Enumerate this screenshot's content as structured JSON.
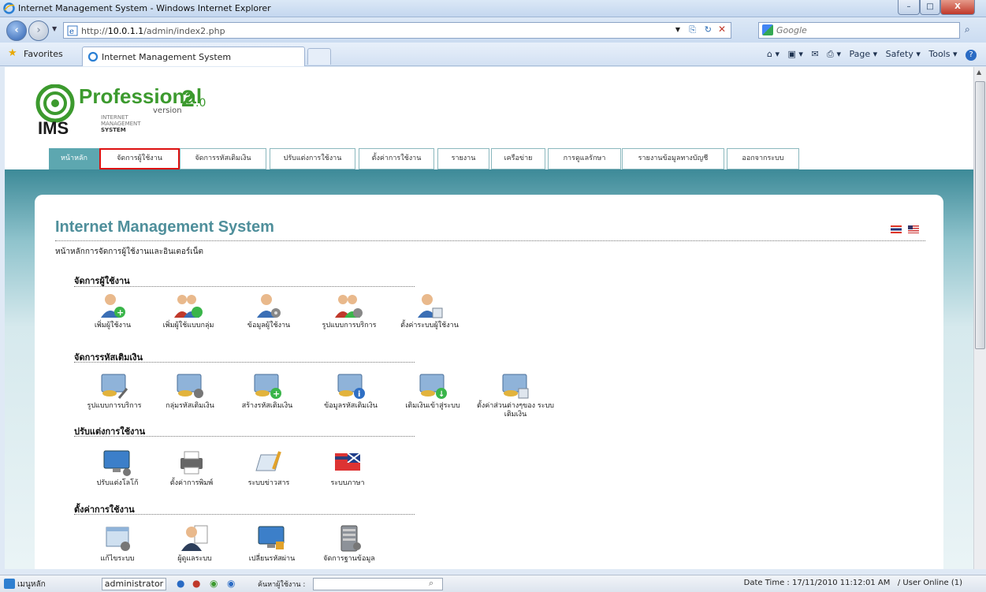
{
  "window": {
    "title": "Internet Management System - Windows Internet Explorer",
    "min": "–",
    "max": "□",
    "close": "X"
  },
  "address": {
    "url_prefix": "http://",
    "url_host": "10.0.1.1",
    "url_path": "/admin/index2.php",
    "search_placeholder": "Google"
  },
  "favbar": {
    "favorites": "Favorites",
    "tab_title": "Internet Management System",
    "page": "Page ▾",
    "safety": "Safety ▾",
    "tools": "Tools ▾",
    "help": "?"
  },
  "logo": {
    "professional": "Professional",
    "two": "2",
    "zero": ".0",
    "version": "version",
    "ims": "IMS",
    "line1": "INTERNET",
    "line2": "MANAGEMENT",
    "line3": "SYSTEM"
  },
  "menu": [
    "หน้าหลัก",
    "จัดการผู้ใช้งาน",
    "จัดการรหัสเติมเงิน",
    "ปรับแต่งการใช้งาน",
    "ตั้งค่าการใช้งาน",
    "รายงาน",
    "เครือข่าย",
    "การดูแลรักษา",
    "รายงานข้อมูลทางบัญชี",
    "ออกจากระบบ"
  ],
  "panel": {
    "title": "Internet Management System",
    "subtitle": "หน้าหลักการจัดการผู้ใช้งานและอินเตอร์เน็ต"
  },
  "sections": [
    {
      "title": "จัดการผู้ใช้งาน",
      "items": [
        "เพิ่มผู้ใช้งาน",
        "เพิ่มผู้ใช้แบบกลุ่ม",
        "ข้อมูลผู้ใช้งาน",
        "รูปแบบการบริการ",
        "ตั้งค่าระบบผู้ใช้งาน"
      ]
    },
    {
      "title": "จัดการรหัสเติมเงิน",
      "items": [
        "รูปแบบการบริการ",
        "กลุ่มรหัสเติมเงิน",
        "สร้างรหัสเติมเงิน",
        "ข้อมูลรหัสเติมเงิน",
        "เติมเงินเข้าสู่ระบบ",
        "ตั้งค่าส่วนต่างๆของ ระบบเติมเงิน"
      ]
    },
    {
      "title": "ปรับแต่งการใช้งาน",
      "items": [
        "ปรับแต่งโลโก้",
        "ตั้งค่าการพิมพ์",
        "ระบบข่าวสาร",
        "ระบบภาษา"
      ]
    },
    {
      "title": "ตั้งค่าการใช้งาน",
      "items": [
        "แก้ไขระบบ",
        "ผู้ดูแลระบบ",
        "เปลี่ยนรหัสผ่าน",
        "จัดการฐานข้อมูล"
      ]
    }
  ],
  "status": {
    "menu": "เมนูหลัก",
    "user": "administrator",
    "search_label": "ค้นหาผู้ใช้งาน :",
    "datetime": "Date Time : 17/11/2010 11:12:01 AM",
    "online": "/ User Online (1)"
  },
  "colors": {
    "accent": "#5da7b0",
    "title_teal": "#4f8f9b",
    "selected_border": "#dd1111"
  }
}
